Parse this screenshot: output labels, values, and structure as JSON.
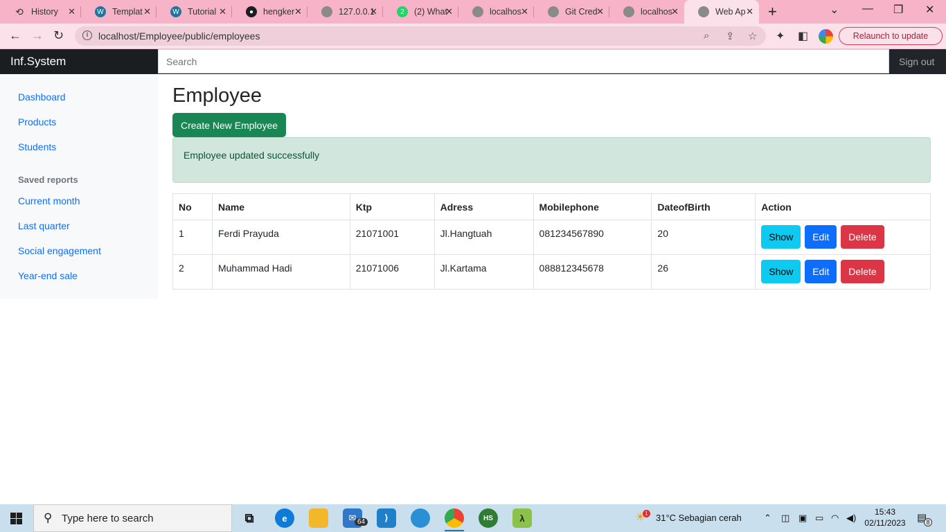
{
  "browser": {
    "tabs": [
      {
        "title": "History",
        "icon": "history-icon"
      },
      {
        "title": "Templat",
        "icon": "wordpress-icon"
      },
      {
        "title": "Tutorial",
        "icon": "wordpress-icon"
      },
      {
        "title": "hengker",
        "icon": "github-icon"
      },
      {
        "title": "127.0.0.1",
        "icon": "globe-icon"
      },
      {
        "title": "(2) What",
        "icon": "whatsapp-icon",
        "badge": "2"
      },
      {
        "title": "localhos",
        "icon": "globe-icon"
      },
      {
        "title": "Git Cred",
        "icon": "globe-icon"
      },
      {
        "title": "localhos",
        "icon": "globe-icon"
      },
      {
        "title": "Web Ap",
        "icon": "globe-icon",
        "active": true
      }
    ],
    "url": "localhost/Employee/public/employees",
    "relaunch_label": "Relaunch to update"
  },
  "app": {
    "brand": "Inf.System",
    "search_placeholder": "Search",
    "sign_out": "Sign out"
  },
  "sidebar": {
    "items": [
      "Dashboard",
      "Products",
      "Students"
    ],
    "saved_reports_heading": "Saved reports",
    "reports": [
      "Current month",
      "Last quarter",
      "Social engagement",
      "Year-end sale"
    ]
  },
  "main": {
    "title": "Employee",
    "create_button": "Create New Employee",
    "alert": "Employee updated successfully",
    "columns": [
      "No",
      "Name",
      "Ktp",
      "Adress",
      "Mobilephone",
      "DateofBirth",
      "Action"
    ],
    "rows": [
      {
        "no": "1",
        "name": "Ferdi Prayuda",
        "ktp": "21071001",
        "adress": "Jl.Hangtuah",
        "mobile": "081234567890",
        "dob": "20"
      },
      {
        "no": "2",
        "name": "Muhammad Hadi",
        "ktp": "21071006",
        "adress": "Jl.Kartama",
        "mobile": "088812345678",
        "dob": "26"
      }
    ],
    "actions": {
      "show": "Show",
      "edit": "Edit",
      "delete": "Delete"
    }
  },
  "taskbar": {
    "search_label": "Type here to search",
    "mail_badge": "64",
    "weather_badge": "1",
    "weather": "31°C  Sebagian cerah",
    "time": "15:43",
    "date": "02/11/2023",
    "notification_count": "8"
  }
}
